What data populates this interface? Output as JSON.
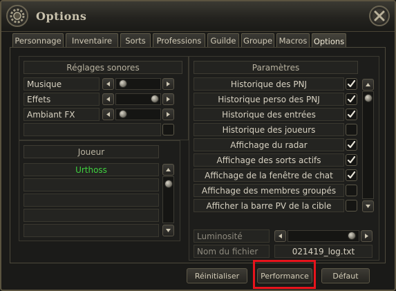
{
  "window": {
    "title": "Options"
  },
  "tabs": [
    {
      "label": "Personnage"
    },
    {
      "label": "Inventaire"
    },
    {
      "label": "Sorts"
    },
    {
      "label": "Professions"
    },
    {
      "label": "Guilde"
    },
    {
      "label": "Groupe"
    },
    {
      "label": "Macros"
    },
    {
      "label": "Options",
      "active": true
    }
  ],
  "sound": {
    "header": "Réglages sonores",
    "rows": [
      {
        "label": "Musique",
        "level": 0.15
      },
      {
        "label": "Effets",
        "level": 0.9
      },
      {
        "label": "Ambiant FX",
        "level": 0.15
      }
    ]
  },
  "player": {
    "header": "Joueur",
    "entries": [
      "Urthoss",
      "",
      "",
      "",
      ""
    ]
  },
  "params": {
    "header": "Paramètres",
    "items": [
      {
        "label": "Historique des PNJ",
        "checked": true
      },
      {
        "label": "Historique perso des PNJ",
        "checked": true
      },
      {
        "label": "Historique des entrées",
        "checked": true
      },
      {
        "label": "Historique des joueurs",
        "checked": false
      },
      {
        "label": "Affichage du radar",
        "checked": true
      },
      {
        "label": "Affichage des sorts actifs",
        "checked": true
      },
      {
        "label": "Affichage de la fenêtre de chat",
        "checked": true
      },
      {
        "label": "Affichage des membres groupés",
        "checked": false
      },
      {
        "label": "Afficher la barre PV de la cible",
        "checked": false
      }
    ]
  },
  "brightness": {
    "label": "Luminosité",
    "level": 0.95
  },
  "filename": {
    "label": "Nom du fichier",
    "value": "021419_log.txt"
  },
  "buttons": {
    "reset": "Réinitialiser",
    "performance": "Performance",
    "default": "Défaut"
  },
  "colors": {
    "accent_highlight": "#e8141c",
    "player_name": "#3fd33f"
  }
}
